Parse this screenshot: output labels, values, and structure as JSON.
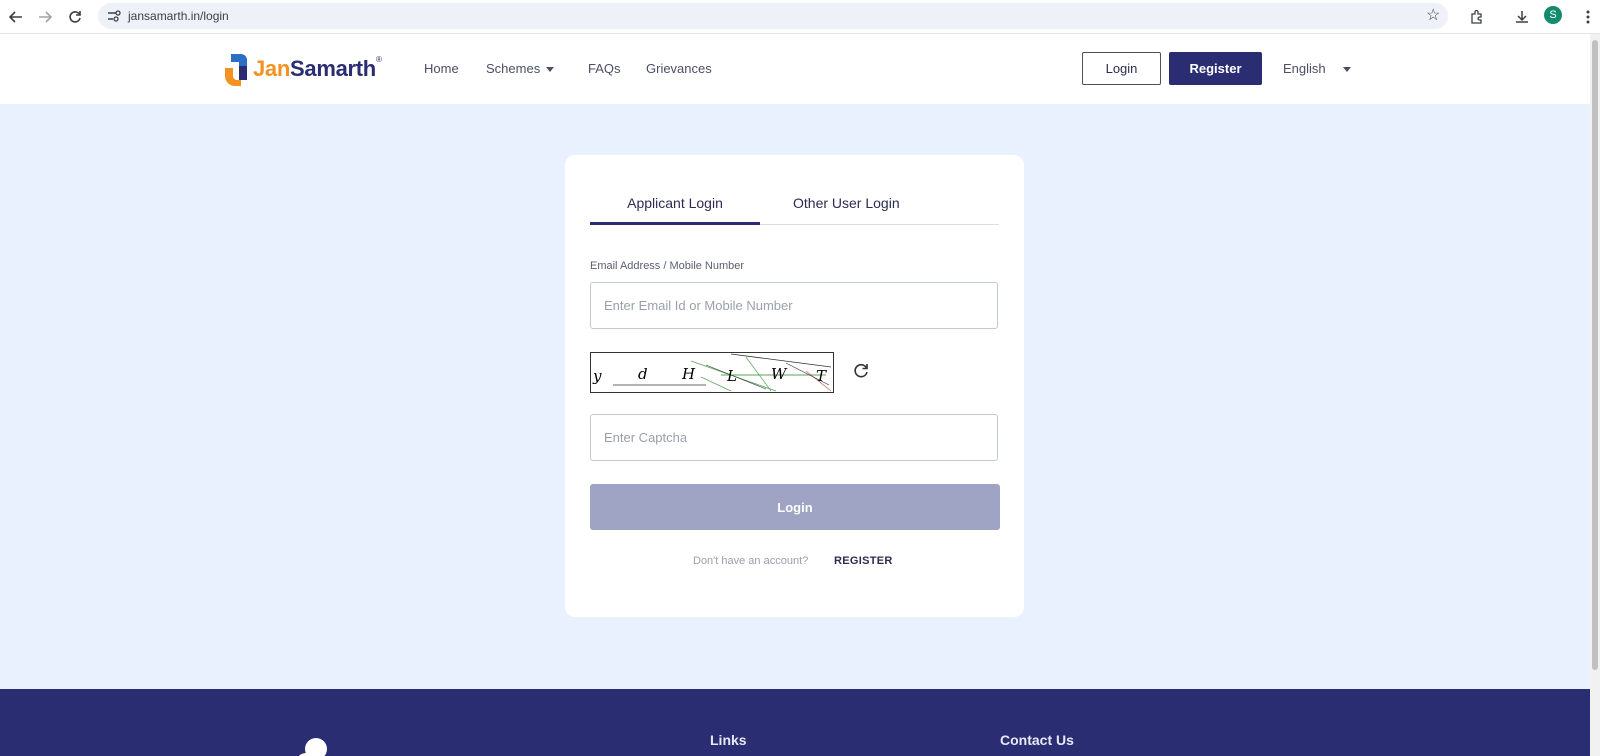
{
  "browser": {
    "url": "jansamarth.in/login",
    "profile_initial": "S"
  },
  "header": {
    "logo_jan": "Jan",
    "logo_samarth": "Samarth",
    "logo_reg": "®",
    "nav": {
      "home": "Home",
      "schemes": "Schemes",
      "faqs": "FAQs",
      "grievances": "Grievances"
    },
    "login_label": "Login",
    "register_label": "Register",
    "language": "English"
  },
  "login_card": {
    "tabs": {
      "applicant": "Applicant Login",
      "other": "Other User Login"
    },
    "email_label": "Email Address / Mobile Number",
    "email_placeholder": "Enter Email Id or Mobile Number",
    "captcha_chars": [
      "y",
      "d",
      "H",
      "L",
      "W",
      "T"
    ],
    "captcha_placeholder": "Enter Captcha",
    "login_button": "Login",
    "no_account_text": "Don't have an account?",
    "register_link": "REGISTER"
  },
  "footer": {
    "links_heading": "Links",
    "contact_heading": "Contact Us"
  },
  "colors": {
    "brand_navy": "#2b2d73",
    "brand_orange": "#f39220",
    "page_bg": "#e8f1fd",
    "disabled_button": "#9fa3c4"
  }
}
